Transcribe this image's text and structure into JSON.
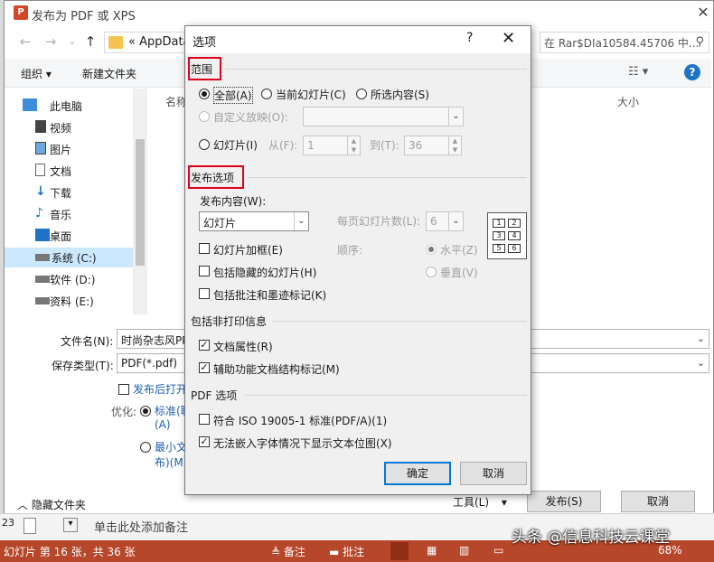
{
  "save_dialog": {
    "title": "发布为 PDF 或 XPS",
    "app_icon_letter": "P",
    "address": "« AppData",
    "search_placeholder": "在 Rar$DIa10584.45706 中...",
    "toolbar": {
      "organize": "组织 ▾",
      "new_folder": "新建文件夹"
    },
    "nav_items": [
      {
        "label": "此电脑",
        "icon": "computer-icon"
      },
      {
        "label": "视频",
        "icon": "video-icon"
      },
      {
        "label": "图片",
        "icon": "picture-icon"
      },
      {
        "label": "文档",
        "icon": "document-icon"
      },
      {
        "label": "下载",
        "icon": "download-icon"
      },
      {
        "label": "音乐",
        "icon": "music-icon"
      },
      {
        "label": "桌面",
        "icon": "desktop-icon"
      },
      {
        "label": "系统 (C:)",
        "icon": "drive-icon"
      },
      {
        "label": "软件 (D:)",
        "icon": "drive-icon"
      },
      {
        "label": "资料 (E:)",
        "icon": "drive-icon"
      }
    ],
    "columns": {
      "name": "名称",
      "size": "大小"
    },
    "filename_label": "文件名(N):",
    "filename_value": "时尚杂志风PPT",
    "filetype_label": "保存类型(T):",
    "filetype_value": "PDF(*.pdf)",
    "open_after": "发布后打开",
    "optimize_label": "优化:",
    "opt_standard_1": "标准(联",
    "opt_standard_2": "(A)",
    "opt_min_1": "最小文",
    "opt_min_2": "布)(M)",
    "hide_folders": "隐藏文件夹",
    "tools": "工具(L)",
    "publish": "发布(S)",
    "cancel": "取消"
  },
  "notes": {
    "placeholder": "单击此处添加备注",
    "slide_no": "23"
  },
  "statusbar": {
    "slide_info": "幻灯片 第 16 张，共 36 张",
    "notes": "备注",
    "comments": "批注",
    "zoom": "68%"
  },
  "options": {
    "title": "选项",
    "help": "?",
    "range_title": "范围",
    "all": "全部(A)",
    "current": "当前幻灯片(C)",
    "selection": "所选内容(S)",
    "custom": "自定义放映(O):",
    "slides": "幻灯片(I)",
    "from_label": "从(F):",
    "from_value": "1",
    "to_label": "到(T):",
    "to_value": "36",
    "publish_title": "发布选项",
    "publish_what": "发布内容(W):",
    "publish_what_value": "幻灯片",
    "per_page": "每页幻灯片数(L):",
    "per_page_value": "6",
    "frame": "幻灯片加框(E)",
    "hidden": "包括隐藏的幻灯片(H)",
    "ink": "包括批注和墨迹标记(K)",
    "order": "顺序:",
    "horizontal": "水平(Z)",
    "vertical": "垂直(V)",
    "nonprint_title": "包括非打印信息",
    "doc_props": "文档属性(R)",
    "struct_tags": "辅助功能文档结构标记(M)",
    "pdf_title": "PDF 选项",
    "iso": "符合 ISO 19005-1 标准(PDF/A)(1)",
    "bitmap": "无法嵌入字体情况下显示文本位图(X)",
    "ok": "确定",
    "cancel": "取消",
    "layout_nums": [
      "1",
      "2",
      "3",
      "4",
      "5",
      "6"
    ]
  },
  "watermark": "头条 @信息科技云课堂",
  "colors": {
    "accent": "#0078d7",
    "ppt": "#b7472a",
    "highlight": "#e0001b"
  }
}
